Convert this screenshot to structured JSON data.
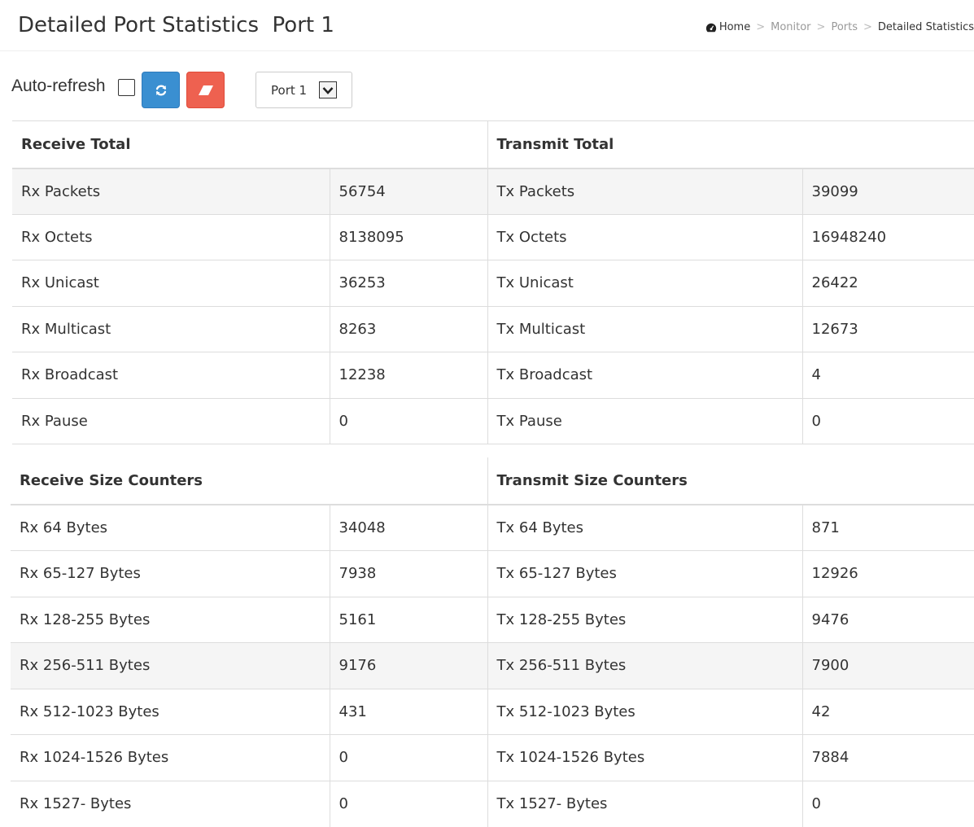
{
  "header": {
    "title": "Detailed Port Statistics  Port 1"
  },
  "breadcrumb": {
    "items": [
      "Home",
      "Monitor",
      "Ports",
      "Detailed Statistics"
    ],
    "separator": ">"
  },
  "toolbar": {
    "auto_refresh_label": "Auto-refresh",
    "auto_refresh_checked": false,
    "refresh_icon": "refresh-icon",
    "clear_icon": "eraser-icon",
    "port_select_value": "Port 1",
    "refresh_color": "#3a8fd1",
    "clear_color": "#ee6150"
  },
  "totals": {
    "receive_header": "Receive Total",
    "transmit_header": "Transmit Total",
    "rows": [
      {
        "rx_label": "Rx Packets",
        "rx_value": "56754",
        "tx_label": "Tx Packets",
        "tx_value": "39099"
      },
      {
        "rx_label": "Rx Octets",
        "rx_value": "8138095",
        "tx_label": "Tx Octets",
        "tx_value": "16948240"
      },
      {
        "rx_label": "Rx Unicast",
        "rx_value": "36253",
        "tx_label": "Tx Unicast",
        "tx_value": "26422"
      },
      {
        "rx_label": "Rx Multicast",
        "rx_value": "8263",
        "tx_label": "Tx Multicast",
        "tx_value": "12673"
      },
      {
        "rx_label": "Rx Broadcast",
        "rx_value": "12238",
        "tx_label": "Tx Broadcast",
        "tx_value": "4"
      },
      {
        "rx_label": "Rx Pause",
        "rx_value": "0",
        "tx_label": "Tx Pause",
        "tx_value": "0"
      }
    ]
  },
  "size_counters": {
    "receive_header": "Receive Size Counters",
    "transmit_header": "Transmit Size Counters",
    "rows": [
      {
        "rx_label": "Rx 64 Bytes",
        "rx_value": "34048",
        "tx_label": "Tx 64 Bytes",
        "tx_value": "871"
      },
      {
        "rx_label": "Rx 65-127 Bytes",
        "rx_value": "7938",
        "tx_label": "Tx 65-127 Bytes",
        "tx_value": "12926"
      },
      {
        "rx_label": "Rx 128-255 Bytes",
        "rx_value": "5161",
        "tx_label": "Tx 128-255 Bytes",
        "tx_value": "9476"
      },
      {
        "rx_label": "Rx 256-511 Bytes",
        "rx_value": "9176",
        "tx_label": "Tx 256-511 Bytes",
        "tx_value": "7900"
      },
      {
        "rx_label": "Rx 512-1023 Bytes",
        "rx_value": "431",
        "tx_label": "Tx 512-1023 Bytes",
        "tx_value": "42"
      },
      {
        "rx_label": "Rx 1024-1526 Bytes",
        "rx_value": "0",
        "tx_label": "Tx 1024-1526 Bytes",
        "tx_value": "7884"
      },
      {
        "rx_label": "Rx 1527- Bytes",
        "rx_value": "0",
        "tx_label": "Tx 1527- Bytes",
        "tx_value": "0"
      }
    ]
  }
}
